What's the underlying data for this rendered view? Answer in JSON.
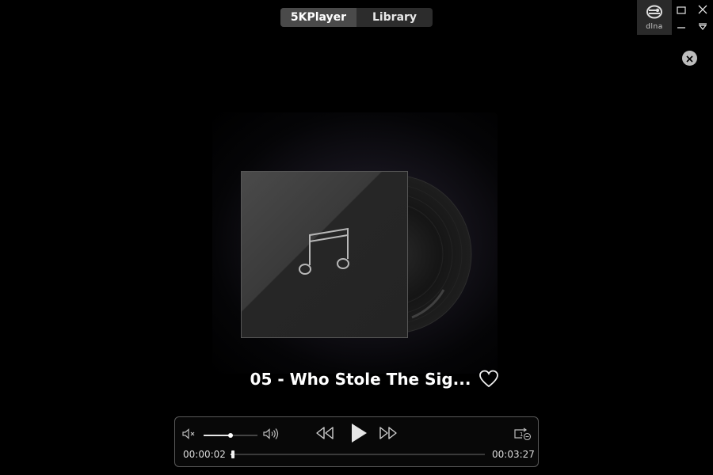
{
  "tabs": [
    {
      "label": "5KPlayer",
      "active": true
    },
    {
      "label": "Library",
      "active": false
    }
  ],
  "window_controls": {
    "dlna_label": "dlna",
    "icons": [
      "dlna-icon",
      "maximize-icon",
      "close-window-icon",
      "minimize-icon",
      "dropdown-menu-icon"
    ]
  },
  "player": {
    "track_title": "05 - Who Stole The Sig...",
    "time_elapsed": "00:00:02",
    "time_total": "00:03:27",
    "progress_fraction": 0.01,
    "volume_fraction": 0.5,
    "favorite": false,
    "placeholder_art_icon": "music-note-icon"
  },
  "colors": {
    "background": "#000000",
    "tab_active": "#4a4a4a",
    "tab_inactive": "#2c2c2c",
    "panel_border": "#5a5a5a"
  }
}
